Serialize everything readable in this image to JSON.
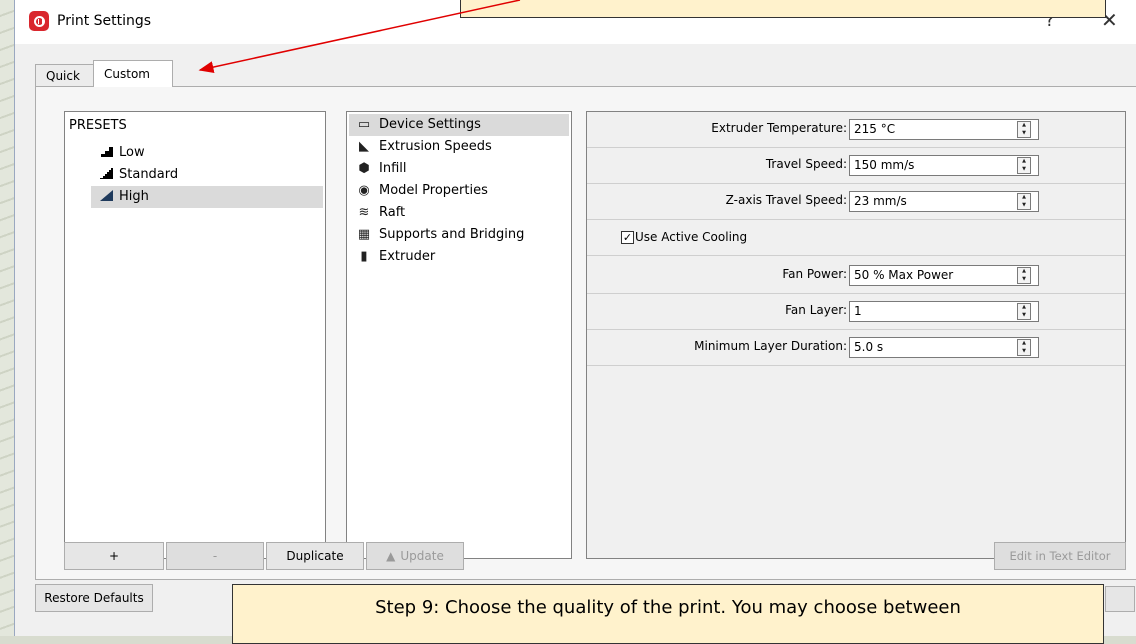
{
  "window": {
    "title": "Print Settings",
    "help_glyph": "?",
    "close_glyph": "✕"
  },
  "tabs": [
    {
      "label": "Quick",
      "active": false
    },
    {
      "label": "Custom",
      "active": true
    }
  ],
  "presets": {
    "header": "PRESETS",
    "items": [
      {
        "label": "Low",
        "icon": "low-quality-icon",
        "selected": false
      },
      {
        "label": "Standard",
        "icon": "standard-quality-icon",
        "selected": false
      },
      {
        "label": "High",
        "icon": "high-quality-icon",
        "selected": true
      }
    ]
  },
  "categories": [
    {
      "label": "Device Settings",
      "icon": "window-icon",
      "selected": true
    },
    {
      "label": "Extrusion Speeds",
      "icon": "rabbit-icon",
      "selected": false
    },
    {
      "label": "Infill",
      "icon": "cube-icon",
      "selected": false
    },
    {
      "label": "Model Properties",
      "icon": "gear-icon",
      "selected": false
    },
    {
      "label": "Raft",
      "icon": "layers-icon",
      "selected": false
    },
    {
      "label": "Supports and Bridging",
      "icon": "support-cube-icon",
      "selected": false
    },
    {
      "label": "Extruder",
      "icon": "extruder-icon",
      "selected": false
    }
  ],
  "settings": {
    "extruder_temperature": {
      "label": "Extruder Temperature:",
      "value": "215 °C"
    },
    "travel_speed": {
      "label": "Travel Speed:",
      "value": "150 mm/s"
    },
    "z_travel_speed": {
      "label": "Z-axis Travel Speed:",
      "value": "23 mm/s"
    },
    "active_cooling": {
      "label": "Use Active Cooling",
      "checked": true
    },
    "fan_power": {
      "label": "Fan Power:",
      "value": "50 % Max Power"
    },
    "fan_layer": {
      "label": "Fan Layer:",
      "value": "1"
    },
    "min_layer_duration": {
      "label": "Minimum Layer Duration:",
      "value": "5.0 s"
    }
  },
  "buttons": {
    "add": "+",
    "remove": "-",
    "duplicate": "Duplicate",
    "update": "Update",
    "edit_text_editor": "Edit in Text Editor",
    "restore_defaults": "Restore Defaults"
  },
  "callout": {
    "text": "Step 9: Choose the quality of the print. You may choose between"
  },
  "colors": {
    "brand_red": "#d9272e",
    "callout_bg": "#fff2cc",
    "arrow": "#e00000"
  }
}
